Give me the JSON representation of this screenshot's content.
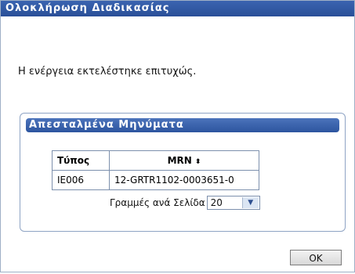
{
  "dialog": {
    "title": "Ολοκλήρωση Διαδικασίας",
    "message": "Η ενέργεια εκτελέστηκε επιτυχώς."
  },
  "panel": {
    "title": "Απεσταλμένα Μηνύματα",
    "table": {
      "columns": [
        "Τύπος",
        "MRN"
      ],
      "sort_icon": "sort-arrows-icon",
      "rows": [
        {
          "type": "IE006",
          "mrn": "12-GRTR1102-0003651-0"
        }
      ]
    },
    "pager": {
      "label": "Γραμμές ανά Σελίδα",
      "rows_per_page": "20"
    }
  },
  "buttons": {
    "ok_label": "OK"
  }
}
